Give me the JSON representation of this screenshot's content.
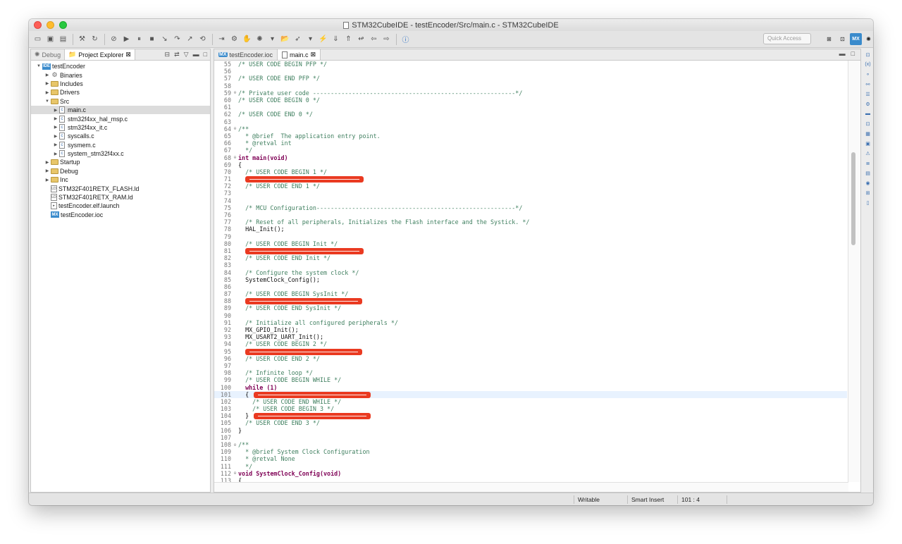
{
  "window": {
    "title": "STM32CubeIDE - testEncoder/Src/main.c - STM32CubeIDE"
  },
  "toolbar": {
    "quick_access_placeholder": "Quick Access"
  },
  "left_panel": {
    "tabs": [
      {
        "label": "Debug",
        "active": false
      },
      {
        "label": "Project Explorer",
        "active": true
      }
    ],
    "tree": [
      {
        "label": "testEncoder",
        "depth": 0,
        "twisty": "▼",
        "icon": "project"
      },
      {
        "label": "Binaries",
        "depth": 1,
        "twisty": "▶",
        "icon": "gear"
      },
      {
        "label": "Includes",
        "depth": 1,
        "twisty": "▶",
        "icon": "folder"
      },
      {
        "label": "Drivers",
        "depth": 1,
        "twisty": "▶",
        "icon": "folder"
      },
      {
        "label": "Src",
        "depth": 1,
        "twisty": "▼",
        "icon": "folder"
      },
      {
        "label": "main.c",
        "depth": 2,
        "twisty": "▶",
        "icon": "file",
        "selected": true
      },
      {
        "label": "stm32f4xx_hal_msp.c",
        "depth": 2,
        "twisty": "▶",
        "icon": "file"
      },
      {
        "label": "stm32f4xx_it.c",
        "depth": 2,
        "twisty": "▶",
        "icon": "file"
      },
      {
        "label": "syscalls.c",
        "depth": 2,
        "twisty": "▶",
        "icon": "file"
      },
      {
        "label": "sysmem.c",
        "depth": 2,
        "twisty": "▶",
        "icon": "file"
      },
      {
        "label": "system_stm32f4xx.c",
        "depth": 2,
        "twisty": "▶",
        "icon": "file"
      },
      {
        "label": "Startup",
        "depth": 1,
        "twisty": "▶",
        "icon": "folder"
      },
      {
        "label": "Debug",
        "depth": 1,
        "twisty": "▶",
        "icon": "folder"
      },
      {
        "label": "Inc",
        "depth": 1,
        "twisty": "▶",
        "icon": "folder"
      },
      {
        "label": "STM32F401RETX_FLASH.ld",
        "depth": 1,
        "twisty": "",
        "icon": "ld"
      },
      {
        "label": "STM32F401RETX_RAM.ld",
        "depth": 1,
        "twisty": "",
        "icon": "ld"
      },
      {
        "label": "testEncoder.elf.launch",
        "depth": 1,
        "twisty": "",
        "icon": "launch"
      },
      {
        "label": "testEncoder.ioc",
        "depth": 1,
        "twisty": "",
        "icon": "mx"
      }
    ]
  },
  "editor": {
    "tabs": [
      {
        "label": "testEncoder.ioc",
        "active": false
      },
      {
        "label": "main.c",
        "active": true
      }
    ],
    "lines": [
      {
        "n": "55",
        "t": "/* USER CODE BEGIN PFP */",
        "k": "comment"
      },
      {
        "n": "56",
        "t": "",
        "k": ""
      },
      {
        "n": "57",
        "t": "/* USER CODE END PFP */",
        "k": "comment"
      },
      {
        "n": "58",
        "t": "",
        "k": ""
      },
      {
        "n": "59",
        "t": "/* Private user code ---------------------------------------------------------*/",
        "k": "comment",
        "fold": "⊖"
      },
      {
        "n": "60",
        "t": "/* USER CODE BEGIN 0 */",
        "k": "comment"
      },
      {
        "n": "61",
        "t": "",
        "k": ""
      },
      {
        "n": "62",
        "t": "/* USER CODE END 0 */",
        "k": "comment"
      },
      {
        "n": "63",
        "t": "",
        "k": ""
      },
      {
        "n": "64",
        "t": "/**",
        "k": "comment",
        "fold": "⊖"
      },
      {
        "n": "65",
        "t": "  * @brief  The application entry point.",
        "k": "comment"
      },
      {
        "n": "66",
        "t": "  * @retval int",
        "k": "comment"
      },
      {
        "n": "67",
        "t": "  */",
        "k": "comment"
      },
      {
        "n": "68",
        "t": "int main(void)",
        "k": "kw",
        "fold": "⊖"
      },
      {
        "n": "69",
        "t": "{",
        "k": ""
      },
      {
        "n": "70",
        "t": "  /* USER CODE BEGIN 1 */",
        "k": "comment"
      },
      {
        "n": "71",
        "t": "",
        "k": ""
      },
      {
        "n": "72",
        "t": "  /* USER CODE END 1 */",
        "k": "comment"
      },
      {
        "n": "73",
        "t": "",
        "k": ""
      },
      {
        "n": "74",
        "t": "",
        "k": ""
      },
      {
        "n": "75",
        "t": "  /* MCU Configuration--------------------------------------------------------*/",
        "k": "comment"
      },
      {
        "n": "76",
        "t": "",
        "k": ""
      },
      {
        "n": "77",
        "t": "  /* Reset of all peripherals, Initializes the Flash interface and the Systick. */",
        "k": "comment"
      },
      {
        "n": "78",
        "t": "  HAL_Init();",
        "k": ""
      },
      {
        "n": "79",
        "t": "",
        "k": ""
      },
      {
        "n": "80",
        "t": "  /* USER CODE BEGIN Init */",
        "k": "comment"
      },
      {
        "n": "81",
        "t": "",
        "k": ""
      },
      {
        "n": "82",
        "t": "  /* USER CODE END Init */",
        "k": "comment"
      },
      {
        "n": "83",
        "t": "",
        "k": ""
      },
      {
        "n": "84",
        "t": "  /* Configure the system clock */",
        "k": "comment"
      },
      {
        "n": "85",
        "t": "  SystemClock_Config();",
        "k": ""
      },
      {
        "n": "86",
        "t": "",
        "k": ""
      },
      {
        "n": "87",
        "t": "  /* USER CODE BEGIN SysInit */",
        "k": "comment"
      },
      {
        "n": "88",
        "t": "",
        "k": ""
      },
      {
        "n": "89",
        "t": "  /* USER CODE END SysInit */",
        "k": "comment"
      },
      {
        "n": "90",
        "t": "",
        "k": ""
      },
      {
        "n": "91",
        "t": "  /* Initialize all configured peripherals */",
        "k": "comment"
      },
      {
        "n": "92",
        "t": "  MX_GPIO_Init();",
        "k": ""
      },
      {
        "n": "93",
        "t": "  MX_USART2_UART_Init();",
        "k": ""
      },
      {
        "n": "94",
        "t": "  /* USER CODE BEGIN 2 */",
        "k": "comment"
      },
      {
        "n": "95",
        "t": "",
        "k": ""
      },
      {
        "n": "96",
        "t": "  /* USER CODE END 2 */",
        "k": "comment"
      },
      {
        "n": "97",
        "t": "",
        "k": ""
      },
      {
        "n": "98",
        "t": "  /* Infinite loop */",
        "k": "comment"
      },
      {
        "n": "99",
        "t": "  /* USER CODE BEGIN WHILE */",
        "k": "comment"
      },
      {
        "n": "100",
        "t": "  while (1)",
        "k": "kw"
      },
      {
        "n": "101",
        "t": "  {",
        "k": "",
        "current": true
      },
      {
        "n": "102",
        "t": "    /* USER CODE END WHILE */",
        "k": "comment"
      },
      {
        "n": "103",
        "t": "    /* USER CODE BEGIN 3 */",
        "k": "comment"
      },
      {
        "n": "104",
        "t": "  }",
        "k": ""
      },
      {
        "n": "105",
        "t": "  /* USER CODE END 3 */",
        "k": "comment"
      },
      {
        "n": "106",
        "t": "}",
        "k": ""
      },
      {
        "n": "107",
        "t": "",
        "k": ""
      },
      {
        "n": "108",
        "t": "/**",
        "k": "comment",
        "fold": "⊖"
      },
      {
        "n": "109",
        "t": "  * @brief System Clock Configuration",
        "k": "comment"
      },
      {
        "n": "110",
        "t": "  * @retval None",
        "k": "comment"
      },
      {
        "n": "111",
        "t": "  */",
        "k": "comment"
      },
      {
        "n": "112",
        "t": "void SystemClock_Config(void)",
        "k": "kw",
        "fold": "⊖"
      },
      {
        "n": "113",
        "t": "{",
        "k": ""
      }
    ]
  },
  "status": {
    "writable": "Writable",
    "insert_mode": "Smart Insert",
    "position": "101 : 4"
  },
  "colors": {
    "comment": "#3f7f5f",
    "keyword": "#7f0055",
    "redaction": "#ea3a21",
    "current_line": "#e8f2fe"
  }
}
